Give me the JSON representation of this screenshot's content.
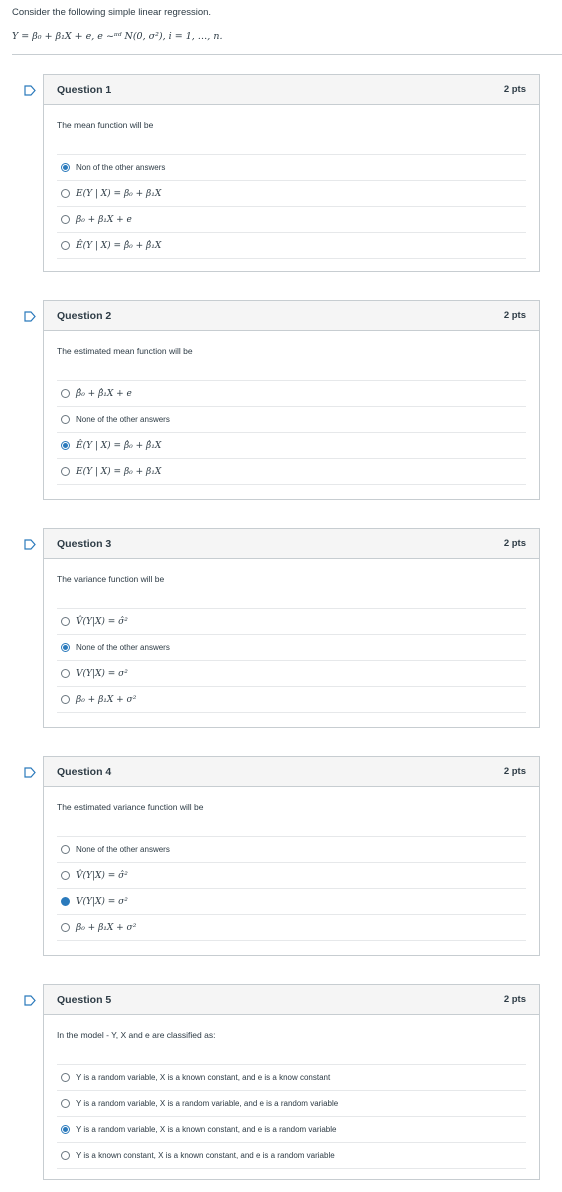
{
  "intro": {
    "text": "Consider the following simple linear regression.",
    "formula": "Y = β₀ + β₁X + e,   e ~ᶦᶦᵈ N(0, σ²),   i = 1, …, n."
  },
  "colors": {
    "accent": "#2b7abc",
    "border": "#c7cdd1",
    "header_bg": "#f5f5f5"
  },
  "questions": [
    {
      "title": "Question 1",
      "points": "2 pts",
      "prompt": "The mean function will be",
      "answers": [
        {
          "label": "Non of the other answers",
          "math": false,
          "selected": true
        },
        {
          "label": "E(Y | X) = β₀ + β₁X",
          "math": true,
          "selected": false
        },
        {
          "label": "β₀ + β₁X + e",
          "math": true,
          "selected": false
        },
        {
          "label": "Ê(Y | X) = β̂₀ + β̂₁X",
          "math": true,
          "selected": false
        }
      ]
    },
    {
      "title": "Question 2",
      "points": "2 pts",
      "prompt": "The estimated mean function will be",
      "answers": [
        {
          "label": "β̂₀ + β̂₁X + e",
          "math": true,
          "selected": false
        },
        {
          "label": "None of the other answers",
          "math": false,
          "selected": false
        },
        {
          "label": "Ê(Y | X) = β̂₀ + β̂₁X",
          "math": true,
          "selected": true
        },
        {
          "label": "E(Y | X) = β₀ + β₁X",
          "math": true,
          "selected": false
        }
      ]
    },
    {
      "title": "Question 3",
      "points": "2 pts",
      "prompt": "The variance function will be",
      "answers": [
        {
          "label": "V̂(Y|X) = σ̂²",
          "math": true,
          "selected": false
        },
        {
          "label": "None of the other answers",
          "math": false,
          "selected": true
        },
        {
          "label": "V(Y|X) = σ²",
          "math": true,
          "selected": false
        },
        {
          "label": "β₀ + β₁X + σ²",
          "math": true,
          "selected": false
        }
      ]
    },
    {
      "title": "Question 4",
      "points": "2 pts",
      "prompt": "The estimated variance function will be",
      "answers": [
        {
          "label": "None of the other answers",
          "math": false,
          "selected": false
        },
        {
          "label": "V̂(Y|X) = σ̂²",
          "math": true,
          "selected": false
        },
        {
          "label": "V(Y|X) = σ²",
          "math": true,
          "selected": true,
          "style": "filled"
        },
        {
          "label": "β₀ + β₁X + σ²",
          "math": true,
          "selected": false
        }
      ]
    },
    {
      "title": "Question 5",
      "points": "2 pts",
      "prompt": "In the model - Y, X and e are classified as:",
      "answers": [
        {
          "label": "Y is a random variable, X is a known constant, and e is a know constant",
          "math": false,
          "selected": false
        },
        {
          "label": "Y is a random variable, X is a random variable, and e is a random variable",
          "math": false,
          "selected": false
        },
        {
          "label": "Y is a random variable, X is a known constant, and e is a random variable",
          "math": false,
          "selected": true
        },
        {
          "label": "Y is a known constant, X is a known constant, and e is a random variable",
          "math": false,
          "selected": false
        }
      ]
    }
  ]
}
